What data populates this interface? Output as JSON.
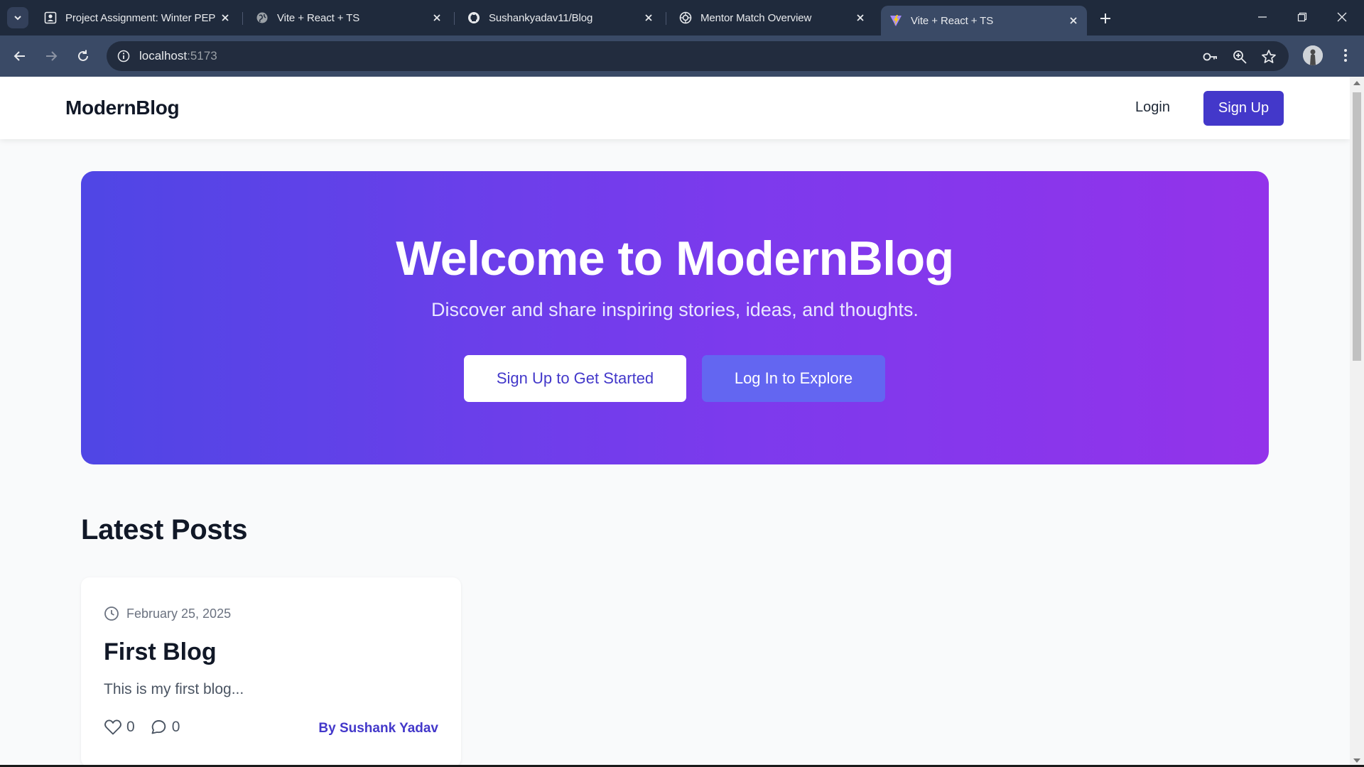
{
  "browser": {
    "tabs": [
      {
        "title": "Project Assignment: Winter PEP",
        "icon": "account-box-icon",
        "active": false
      },
      {
        "title": "Vite + React + TS",
        "icon": "globe-icon",
        "active": false
      },
      {
        "title": "Sushankyadav11/Blog",
        "icon": "github-icon",
        "active": false
      },
      {
        "title": "Mentor Match Overview",
        "icon": "openai-icon",
        "active": false
      },
      {
        "title": "Vite + React + TS",
        "icon": "vite-icon",
        "active": true
      }
    ],
    "address": {
      "host": "localhost",
      "port": ":5173"
    }
  },
  "site": {
    "brand": "ModernBlog",
    "nav": {
      "login": "Login",
      "signup": "Sign Up"
    },
    "hero": {
      "title": "Welcome to ModernBlog",
      "subtitle": "Discover and share inspiring stories, ideas, and thoughts.",
      "primary_cta": "Sign Up to Get Started",
      "secondary_cta": "Log In to Explore"
    },
    "latest": {
      "heading": "Latest Posts",
      "posts": [
        {
          "date": "February 25, 2025",
          "title": "First Blog",
          "excerpt": "This is my first blog...",
          "likes": "0",
          "comments": "0",
          "author": "By Sushank Yadav"
        }
      ]
    }
  },
  "colors": {
    "brand_primary": "#4338ca",
    "hero_gradient_start": "#4f46e5",
    "hero_gradient_end": "#9333ea",
    "secondary_button": "#6366f1",
    "chrome_dark": "#1f2a3c",
    "chrome_toolbar": "#3a4a66"
  }
}
